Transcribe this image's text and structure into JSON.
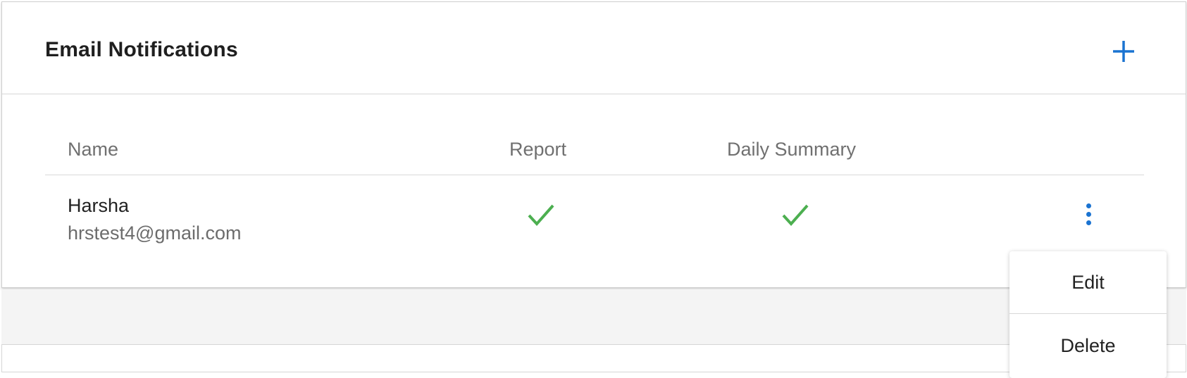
{
  "panel": {
    "title": "Email Notifications",
    "add_icon": "plus-icon"
  },
  "table": {
    "headers": [
      "Name",
      "Report",
      "Daily Summary"
    ],
    "rows": [
      {
        "name": "Harsha",
        "email": "hrstest4@gmail.com",
        "report": true,
        "daily_summary": true,
        "status_icon": "check-icon",
        "menu_icon": "more-vertical-icon"
      }
    ]
  },
  "context_menu": {
    "items": [
      "Edit",
      "Delete"
    ]
  },
  "colors": {
    "accent": "#1a73d1",
    "check": "#4caf50",
    "header_text": "#707070"
  }
}
